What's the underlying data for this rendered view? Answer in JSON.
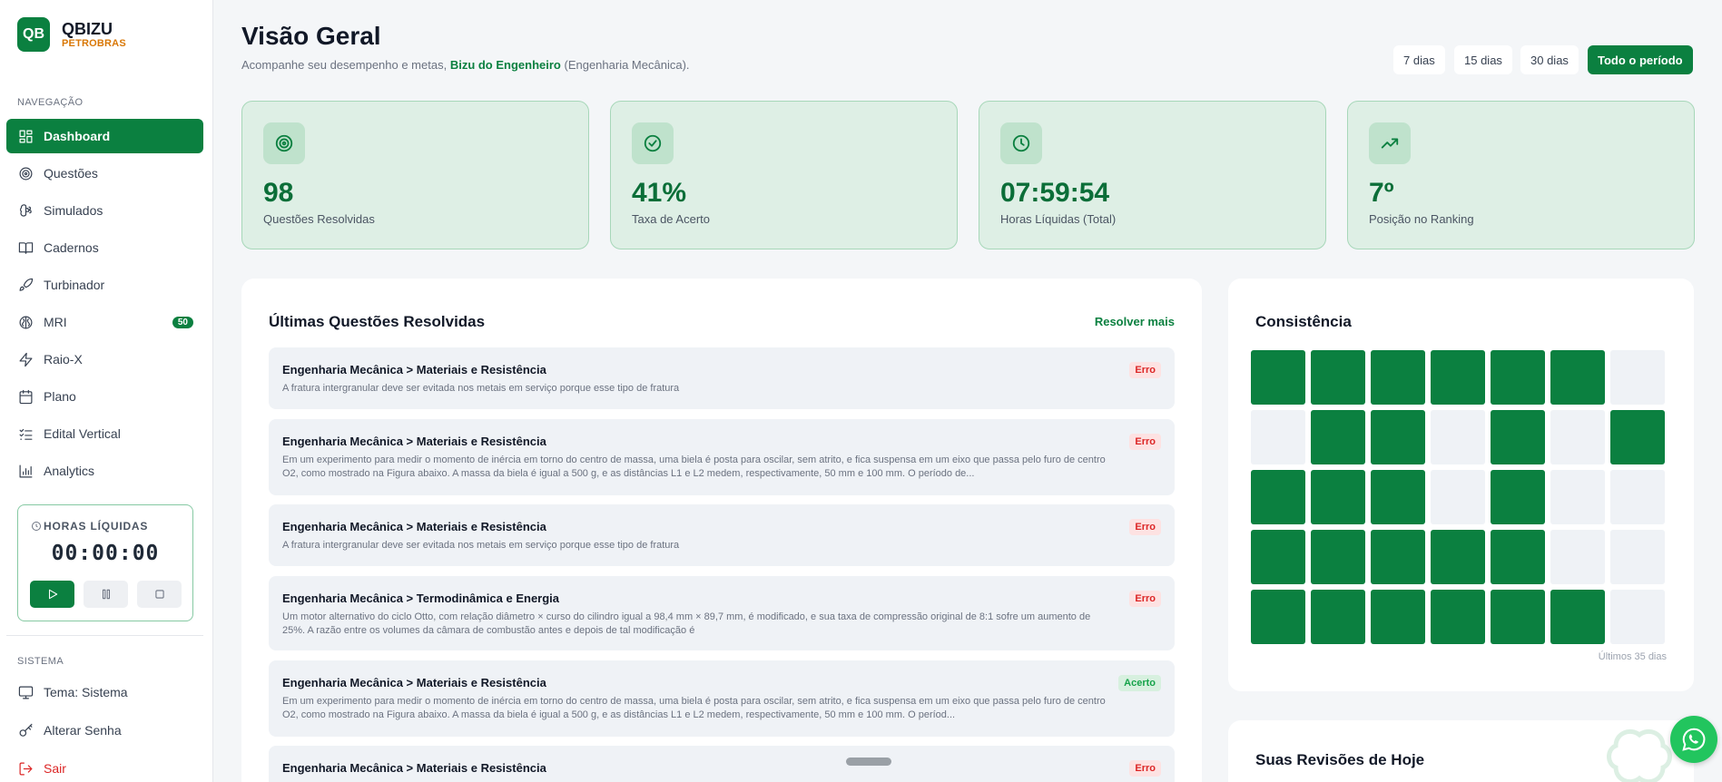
{
  "brand": {
    "logo": "QB",
    "name": "QBIZU",
    "sub": "PETROBRAS"
  },
  "sidebar": {
    "nav_label": "NAVEGAÇÃO",
    "items": [
      {
        "label": "Dashboard",
        "icon": "dashboard-icon",
        "active": true
      },
      {
        "label": "Questões",
        "icon": "target-icon"
      },
      {
        "label": "Simulados",
        "icon": "brain-icon"
      },
      {
        "label": "Cadernos",
        "icon": "book-open-icon"
      },
      {
        "label": "Turbinador",
        "icon": "rocket-icon"
      },
      {
        "label": "MRI",
        "icon": "brain-scan-icon",
        "badge": "50"
      },
      {
        "label": "Raio-X",
        "icon": "lightning-icon"
      },
      {
        "label": "Plano",
        "icon": "calendar-icon"
      },
      {
        "label": "Edital Vertical",
        "icon": "checklist-icon"
      },
      {
        "label": "Analytics",
        "icon": "bar-chart-icon"
      }
    ],
    "timer": {
      "label": "HORAS LÍQUIDAS",
      "value": "00:00:00"
    },
    "system_label": "SISTEMA",
    "system_items": [
      {
        "label": "Tema: Sistema",
        "icon": "monitor-icon"
      },
      {
        "label": "Alterar Senha",
        "icon": "key-icon"
      },
      {
        "label": "Sair",
        "icon": "logout-icon"
      }
    ]
  },
  "header": {
    "title": "Visão Geral",
    "subtitle_prefix": "Acompanhe seu desempenho e metas, ",
    "subtitle_highlight": "Bizu do Engenheiro",
    "subtitle_suffix": " (Engenharia Mecânica).",
    "periods": [
      "7 dias",
      "15 dias",
      "30 dias",
      "Todo o período"
    ],
    "active_period": "Todo o período"
  },
  "stats": [
    {
      "value": "98",
      "label": "Questões Resolvidas",
      "icon": "target-icon"
    },
    {
      "value": "41%",
      "label": "Taxa de Acerto",
      "icon": "check-circle-icon"
    },
    {
      "value": "07:59:54",
      "label": "Horas Líquidas (Total)",
      "icon": "clock-icon"
    },
    {
      "value": "7º",
      "label": "Posição no Ranking",
      "icon": "trending-up-icon"
    }
  ],
  "recent": {
    "title": "Últimas Questões Resolvidas",
    "link": "Resolver mais",
    "items": [
      {
        "title": "Engenharia Mecânica > Materiais e Resistência",
        "text": "A fratura intergranular deve ser evitada nos metais em serviço porque esse tipo de fratura",
        "status": "Erro"
      },
      {
        "title": "Engenharia Mecânica > Materiais e Resistência",
        "text": "Em um experimento para medir o momento de inércia em torno do centro de massa, uma biela é posta para oscilar, sem atrito, e fica suspensa em um eixo que passa pelo furo de centro O2, como mostrado na Figura abaixo. A massa da biela é igual a 500 g, e as distâncias L1 e L2 medem, respectivamente, 50 mm e 100 mm. O período de...",
        "status": "Erro"
      },
      {
        "title": "Engenharia Mecânica > Materiais e Resistência",
        "text": "A fratura intergranular deve ser evitada nos metais em serviço porque esse tipo de fratura",
        "status": "Erro"
      },
      {
        "title": "Engenharia Mecânica > Termodinâmica e Energia",
        "text": "Um motor alternativo do ciclo Otto, com relação diâmetro × curso do cilindro igual a 98,4 mm × 89,7 mm, é modificado, e sua taxa de compressão original de 8:1 sofre um aumento de 25%. A razão entre os volumes da câmara de combustão antes e depois de tal modificação é",
        "status": "Erro"
      },
      {
        "title": "Engenharia Mecânica > Materiais e Resistência",
        "text": "Em um experimento para medir o momento de inércia em torno do centro de massa, uma biela é posta para oscilar, sem atrito, e fica suspensa em um eixo que passa pelo furo de centro O2, como mostrado na Figura abaixo. A massa da biela é igual a 500 g, e as distâncias L1 e L2 medem, respectivamente, 50 mm e 100 mm. O períod...",
        "status": "Acerto"
      },
      {
        "title": "Engenharia Mecânica > Materiais e Resistência",
        "text": "",
        "status": "Erro"
      }
    ]
  },
  "consistency": {
    "title": "Consistência",
    "footer": "Últimos 35 dias",
    "days": [
      1,
      1,
      1,
      1,
      1,
      1,
      0,
      0,
      1,
      1,
      0,
      1,
      0,
      1,
      1,
      1,
      1,
      0,
      1,
      0,
      0,
      1,
      1,
      1,
      1,
      1,
      0,
      0,
      1,
      1,
      1,
      1,
      1,
      1,
      0
    ]
  },
  "reviews": {
    "title": "Suas Revisões de Hoje"
  },
  "colors": {
    "primary": "#0b8040",
    "accent": "#d97706",
    "error": "#dc2626",
    "success": "#16a34a"
  }
}
